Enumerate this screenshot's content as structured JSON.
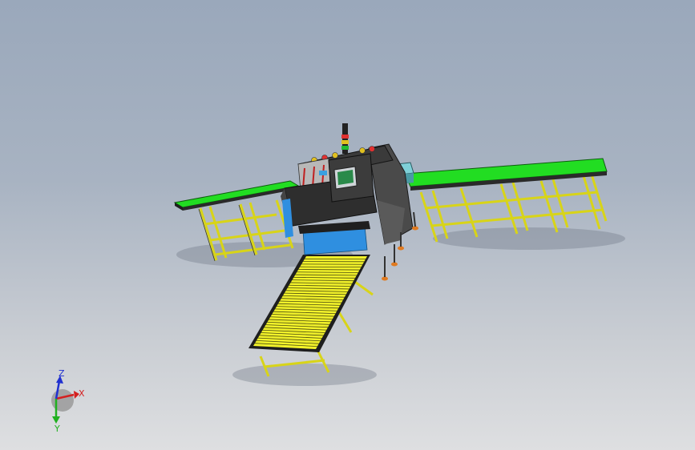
{
  "viewport": {
    "background_top": "#9aa8bb",
    "background_bottom": "#dedfe1"
  },
  "triad": {
    "x_label": "X",
    "y_label": "Y",
    "z_label": "Z",
    "x_color": "#d42020",
    "y_color": "#20b020",
    "z_color": "#2030d0"
  },
  "model": {
    "conveyor_belt_color": "#22dd22",
    "roller_color": "#f2f22a",
    "frame_color": "#d8d418",
    "machine_color": "#2e2e2e",
    "panel_color": "#2f8fe0",
    "screen_color": "#2a8a4a",
    "icons": [
      "stack-light-icon",
      "hmi-screen-icon",
      "emergency-stop-icon"
    ]
  }
}
